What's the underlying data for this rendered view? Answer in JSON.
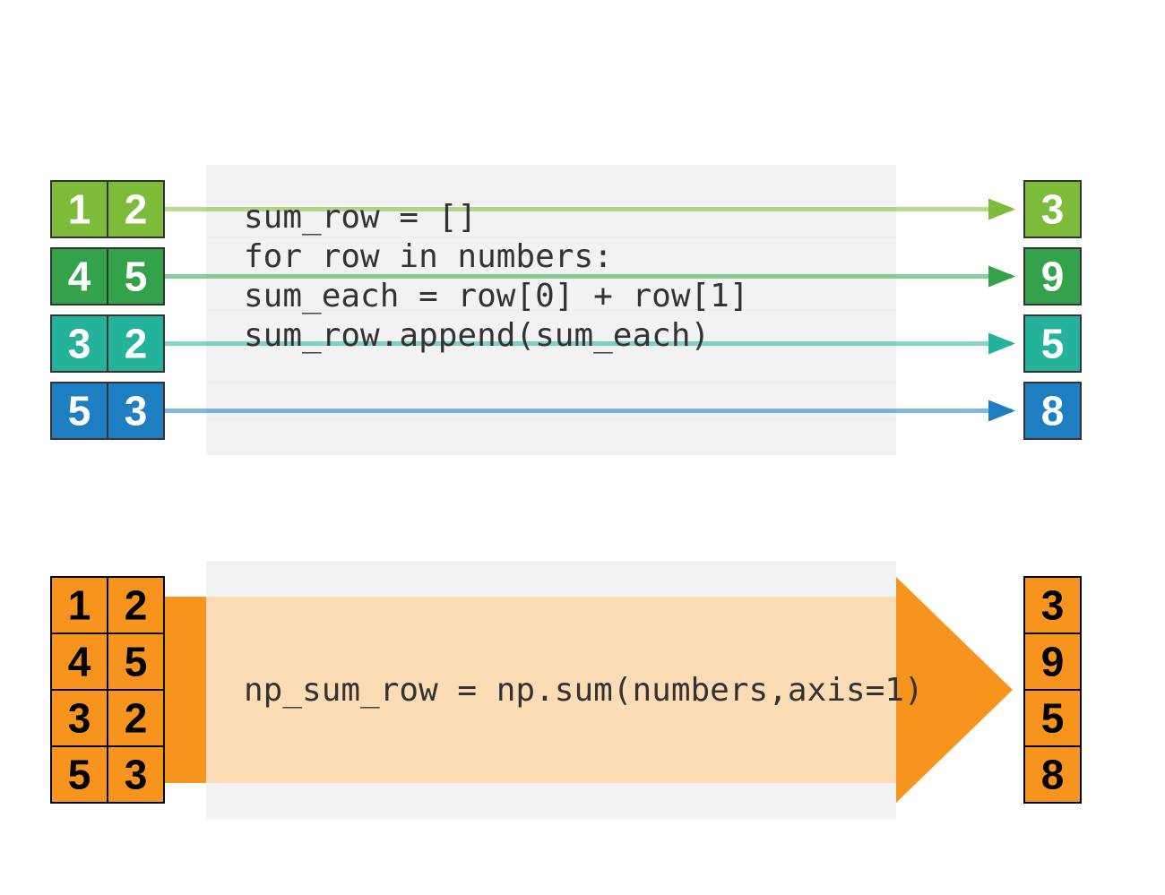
{
  "colors": {
    "row1": "#7DBB3B",
    "row2": "#33A24A",
    "row3": "#24B39A",
    "row4": "#1D7EC2",
    "orange": "#F7941E",
    "orangeTint": "#FDE6CB",
    "codeBg": "#F2F2F2",
    "gridLine": "#EEEEEE",
    "cellBorderTop": "#333333",
    "cellBorderBottom": "#000000"
  },
  "top": {
    "matrix": [
      [
        1,
        2
      ],
      [
        4,
        5
      ],
      [
        3,
        2
      ],
      [
        5,
        3
      ]
    ],
    "result": [
      3,
      9,
      5,
      8
    ],
    "code": [
      "sum_row = []",
      "for row in numbers:",
      "    sum_each = row[0] + row[1]",
      "    sum_row.append(sum_each)"
    ]
  },
  "bottom": {
    "matrix": [
      [
        1,
        2
      ],
      [
        4,
        5
      ],
      [
        3,
        2
      ],
      [
        5,
        3
      ]
    ],
    "result": [
      3,
      9,
      5,
      8
    ],
    "code": "np_sum_row = np.sum(numbers,axis=1)"
  }
}
